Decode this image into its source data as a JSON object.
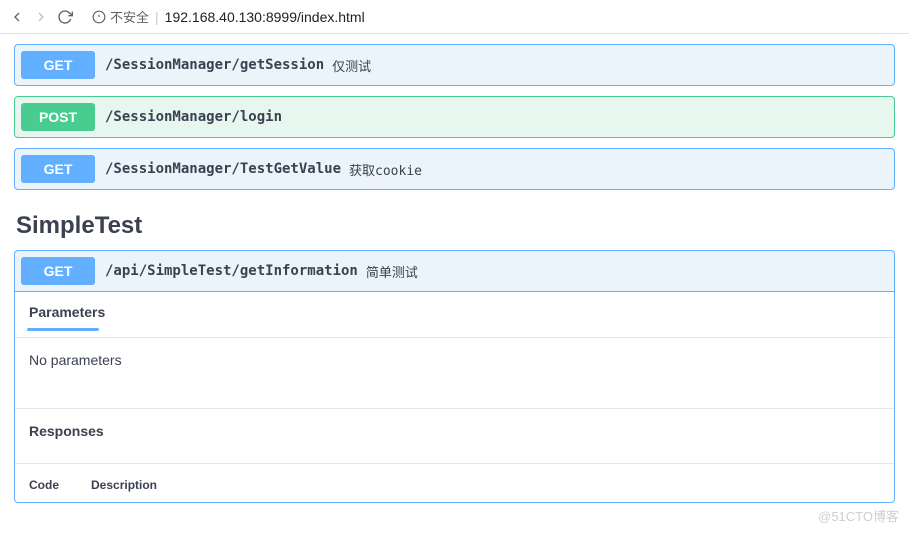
{
  "browser": {
    "security_label": "不安全",
    "url": "192.168.40.130:8999/index.html"
  },
  "endpoints": [
    {
      "method": "GET",
      "path": "/SessionManager/getSession",
      "summary": "仅测试"
    },
    {
      "method": "POST",
      "path": "/SessionManager/login",
      "summary": ""
    },
    {
      "method": "GET",
      "path": "/SessionManager/TestGetValue",
      "summary": "获取cookie"
    }
  ],
  "section": {
    "title": "SimpleTest",
    "endpoint": {
      "method": "GET",
      "path": "/api/SimpleTest/getInformation",
      "summary": "简单测试"
    },
    "parameters_label": "Parameters",
    "no_parameters_text": "No parameters",
    "responses_label": "Responses",
    "columns": {
      "code": "Code",
      "description": "Description"
    }
  },
  "watermark": "@51CTO博客"
}
